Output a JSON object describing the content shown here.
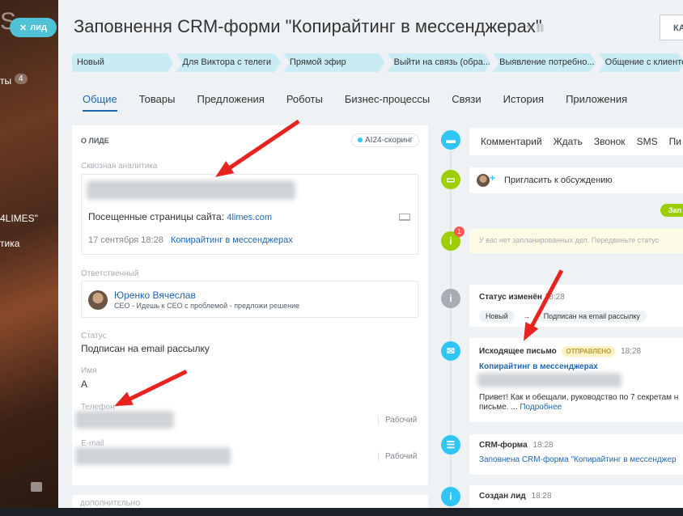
{
  "sidebar": {
    "logo": "S",
    "lead_button": "лид",
    "count_label": "ты",
    "count": "4",
    "company": "4LIMES\"",
    "item": "тика"
  },
  "header": {
    "title": "Заповнення CRM-форми \"Копирайтинг в  мессенджерах\"",
    "right_button": "КА"
  },
  "stages": [
    "Новый",
    "Для Виктора с телеги",
    "Прямой эфир",
    "Выйти на связь (обра...",
    "Выявление потребно...",
    "Общение с клиентом"
  ],
  "tabs": [
    "Общие",
    "Товары",
    "Предложения",
    "Роботы",
    "Бизнес-процессы",
    "Связи",
    "История",
    "Приложения"
  ],
  "lead": {
    "section_title": "О ЛИДЕ",
    "ai_badge": "AI24-скоринг",
    "analytics_label": "Сквозная аналитика",
    "visited_label": "Посещенные страницы сайта:",
    "visited_link": "4limes.com",
    "visit_date": "17 сентября 18:28",
    "visit_link": "Копирайтинг в мессенджерах",
    "responsible_label": "Ответственный",
    "responsible_name": "Юренко Вячеслав",
    "responsible_position": "CEO - Идешь к CEO с проблемой - предложи решение",
    "status_label": "Статус",
    "status_value": "Подписан на email рассылку",
    "name_label": "Имя",
    "name_value": "А",
    "phone_label": "Телефон",
    "phone_type": "Рабочий",
    "email_label": "E-mail",
    "email_type": "Рабочий",
    "extra_title": "ДОПОЛНИТЕЛЬНО"
  },
  "timeline": {
    "actions": [
      "Комментарий",
      "Ждать",
      "Звонок",
      "SMS",
      "Пи"
    ],
    "invite": "Пригласить к обсуждению",
    "green_tag": "Зап",
    "notice_count": "1",
    "notice": "У вас нет запланированных дел. Передвиньте статус",
    "status_change_title": "Статус изменён",
    "status_change_time": "18:28",
    "status_from": "Новый",
    "status_arrow": "→",
    "status_to": "Подписан на email рассылку",
    "email_title": "Исходящее письмо",
    "email_badge": "ОТПРАВЛЕНО",
    "email_time": "18:28",
    "email_subject": "Копирайтинг в мессенджерах",
    "email_body_1": "Привет! Как и обещали, руководство по 7 секретам н",
    "email_body_2": "письме. ...",
    "email_more": "Подробнее",
    "form_title": "CRM-форма",
    "form_time": "18:28",
    "form_text": "Заповнена CRM-форма \"Копирайтинг в мессенджер",
    "created_title": "Создан лид",
    "created_time": "18:28"
  }
}
